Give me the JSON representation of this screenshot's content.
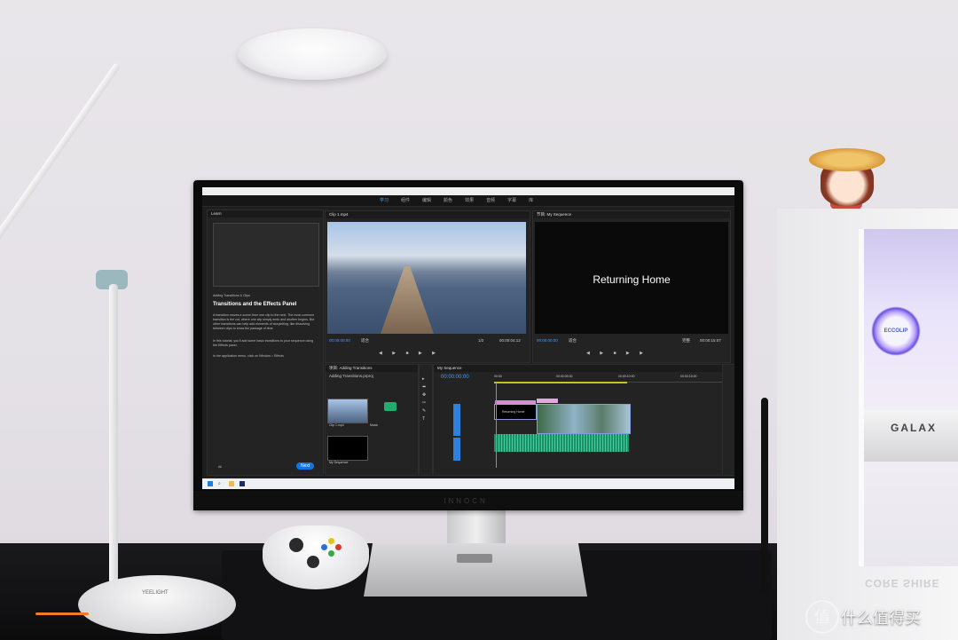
{
  "watermark": {
    "logo_glyph": "值",
    "text": "什么值得买"
  },
  "monitor": {
    "brand": "INNOCN"
  },
  "lamp": {
    "logo": "YEELIGHT"
  },
  "pc": {
    "cooler_label": "ECCOLIP",
    "gpu_label": "GALAX",
    "psu_label": "CORE SHIRE"
  },
  "app": {
    "menu": [
      "学习",
      "组件",
      "编辑",
      "颜色",
      "效果",
      "音频",
      "字幕",
      "库"
    ],
    "active_menu": 0,
    "learn_panel": {
      "header": "Learn",
      "section_label": "Adding Transitions & Clips",
      "title": "Transitions and the Effects Panel",
      "body": "A transition moves a scene from one clip to the next. The most common transition is the cut, where one clip simply ends and another begins. But other transitions can help add elements of storytelling, like dissolving between clips to show the passage of time.",
      "body2": "In this tutorial, you'll add some basic transitions to your sequence using the Effects panel.",
      "step": "In the application menu, click on Window > Effects",
      "all_label": "All",
      "next_button": "Next"
    },
    "source_panel": {
      "header": "Clip 1.mp4",
      "timecode_left": "00:00:00:00",
      "fit": "适合",
      "ratio": "1/2",
      "timecode_right": "00:00:04:12"
    },
    "program_panel": {
      "header": "节目: My Sequence",
      "title_text": "Returning Home",
      "timecode_left": "00:00:00:00",
      "fit": "适合",
      "ratio": "完整",
      "timecode_right": "00:00:15:07"
    },
    "project_panel": {
      "header": "项目: Adding Transitions",
      "file": "Adding Transitions.prproj",
      "clips": [
        {
          "name": "Clip 1.mp4",
          "dur": "4:12"
        },
        {
          "name": "Clip 2.mp4",
          "dur": "12:14"
        },
        {
          "name": "Music",
          "dur": "1:01:12405"
        },
        {
          "name": "My Sequence",
          "dur": "15:07"
        }
      ]
    },
    "timeline": {
      "header": "My Sequence",
      "timecode": "00:00:00:00",
      "ruler": [
        "00:00",
        "00:00:05:00",
        "00:00:10:00",
        "00:00:15:00"
      ],
      "title_clip": "Returning Home",
      "tracks": [
        "V3",
        "V2",
        "V1",
        "A1",
        "A2",
        "A3"
      ]
    }
  }
}
